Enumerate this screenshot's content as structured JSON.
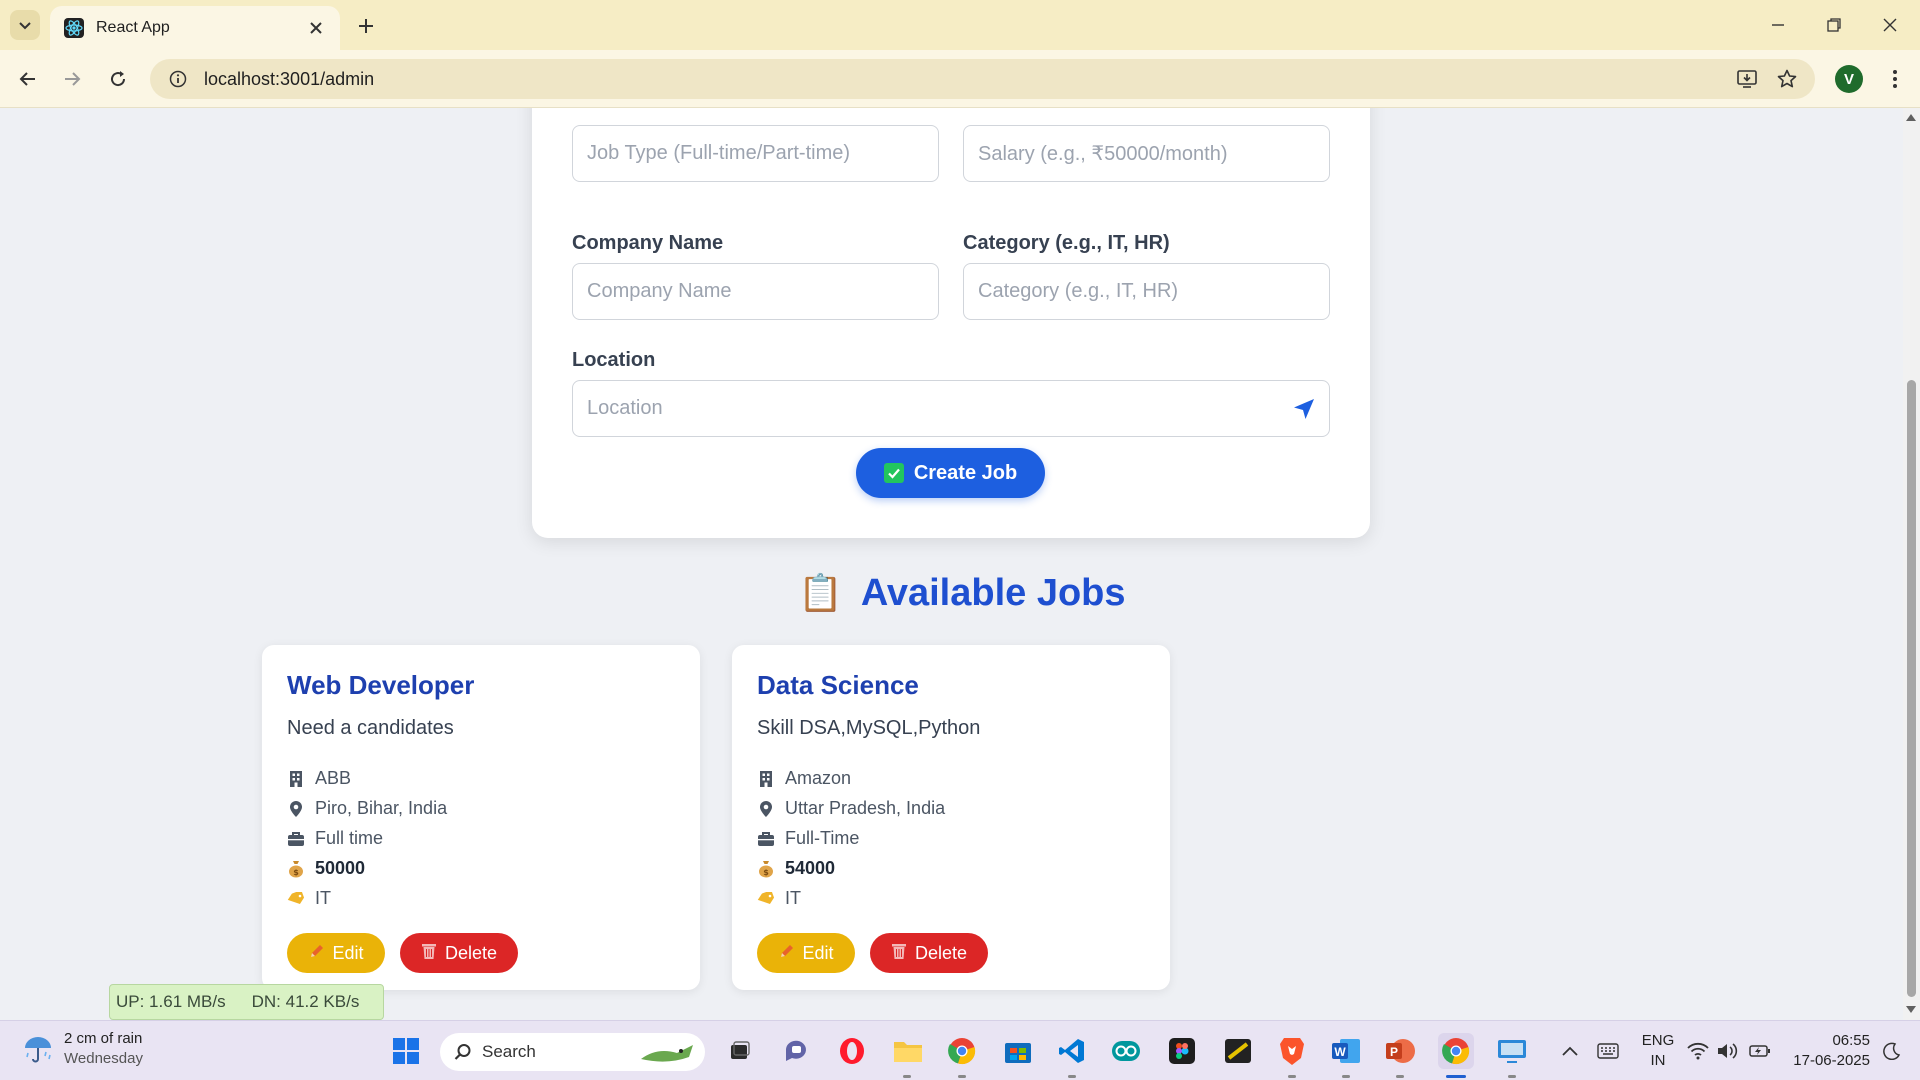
{
  "browser": {
    "tab_title": "React App",
    "url": "localhost:3001/admin",
    "profile_initial": "V"
  },
  "form": {
    "job_type_placeholder": "Job Type (Full-time/Part-time)",
    "salary_placeholder": "Salary (e.g., ₹50000/month)",
    "company_label": "Company Name",
    "company_placeholder": "Company Name",
    "category_label": "Category (e.g., IT, HR)",
    "category_placeholder": "Category (e.g., IT, HR)",
    "location_label": "Location",
    "location_placeholder": "Location",
    "submit_label": "Create Job"
  },
  "jobs_section": {
    "emoji": "📋",
    "title": "Available Jobs"
  },
  "jobs": [
    {
      "title": "Web Developer",
      "description": "Need a candidates",
      "company": "ABB",
      "location": "Piro, Bihar, India",
      "type": "Full time",
      "salary": "50000",
      "category": "IT",
      "edit_label": "Edit",
      "delete_label": "Delete"
    },
    {
      "title": "Data Science",
      "description": "Skill DSA,MySQL,Python",
      "company": "Amazon",
      "location": "Uttar Pradesh, India",
      "type": "Full-Time",
      "salary": "54000",
      "category": "IT",
      "edit_label": "Edit",
      "delete_label": "Delete"
    }
  ],
  "netspeed": {
    "up": "UP: 1.61 MB/s",
    "down": "DN: 41.2 KB/s"
  },
  "taskbar": {
    "weather_main": "2 cm of rain",
    "weather_sub": "Wednesday",
    "search_label": "Search",
    "lang_line1": "ENG",
    "lang_line2": "IN",
    "time": "06:55",
    "date": "17-06-2025"
  },
  "colors": {
    "primary": "#1d5fe0",
    "heading": "#1e40af",
    "edit": "#eab308",
    "delete": "#dc2626",
    "tabstrip": "#f6edc5"
  }
}
